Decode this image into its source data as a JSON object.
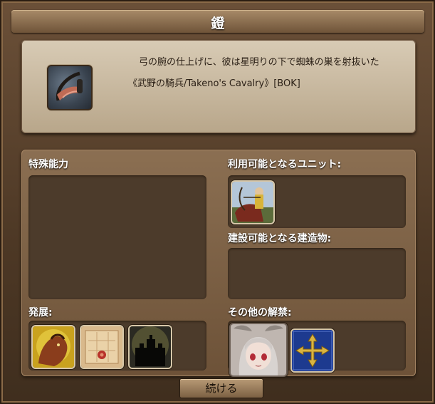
{
  "window": {
    "title": "鐙"
  },
  "intro": {
    "quote": "弓の腕の仕上げに、彼は星明りの下で蜘蛛の巣を射抜いた",
    "unit_line": "《武野の騎兵/Takeno's Cavalry》[BOK]"
  },
  "sections": {
    "special_abilities": "特殊能力",
    "available_units": "利用可能となるユニット:",
    "buildable_structures": "建設可能となる建造物:",
    "development": "発展:",
    "other_unlocks": "その他の解禁:"
  },
  "icons": {
    "tech": "stirrup-icon",
    "unit": "mounted-archer-icon",
    "development": [
      "beast-icon",
      "map-scroll-icon",
      "castle-silhouette-icon"
    ],
    "other": [
      "character-portrait-icon",
      "compass-cross-icon"
    ]
  },
  "buttons": {
    "continue": "続ける"
  }
}
